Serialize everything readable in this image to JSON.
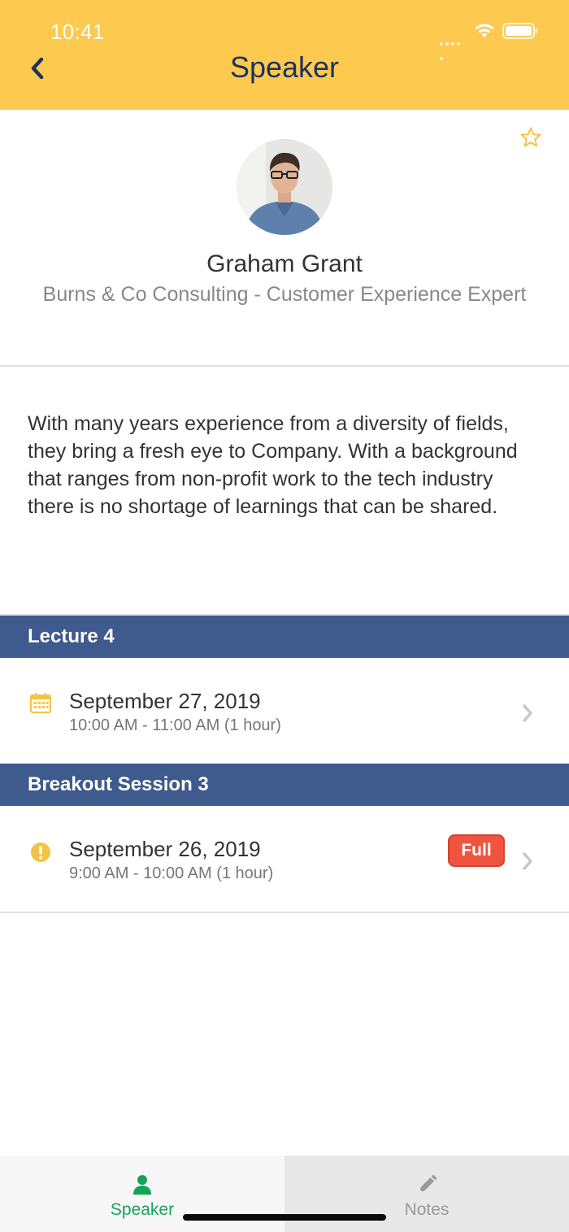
{
  "status_bar": {
    "time": "10:41"
  },
  "header": {
    "title": "Speaker",
    "back_icon": "chevron-left-icon",
    "background_color": "#fdc94f",
    "title_color": "#1e3260"
  },
  "speaker": {
    "name": "Graham Grant",
    "role": "Burns & Co Consulting - Customer Experience Expert",
    "favorite_icon": "star-outline-icon",
    "bio": "With many years experience from a diversity of fields, they bring a fresh eye to Company. With a background that ranges from non-profit work to the tech industry there is no shortage of learnings that can be shared."
  },
  "sessions": [
    {
      "title": "Lecture 4",
      "date": "September 27, 2019",
      "time": "10:00 AM - 11:00 AM  (1 hour)",
      "icon": "calendar-icon",
      "badge": ""
    },
    {
      "title": "Breakout Session 3",
      "date": "September 26, 2019",
      "time": "9:00 AM - 10:00 AM  (1 hour)",
      "icon": "alert-icon",
      "badge": "Full"
    }
  ],
  "tabbar": {
    "tabs": [
      {
        "label": "Speaker",
        "icon": "person-icon",
        "active": true
      },
      {
        "label": "Notes",
        "icon": "pencil-icon",
        "active": false
      }
    ]
  },
  "colors": {
    "section_header": "#3f5a8d",
    "badge_full": "#ee5440",
    "active_tab": "#15a35a",
    "accent_yellow": "#fdc94f"
  }
}
